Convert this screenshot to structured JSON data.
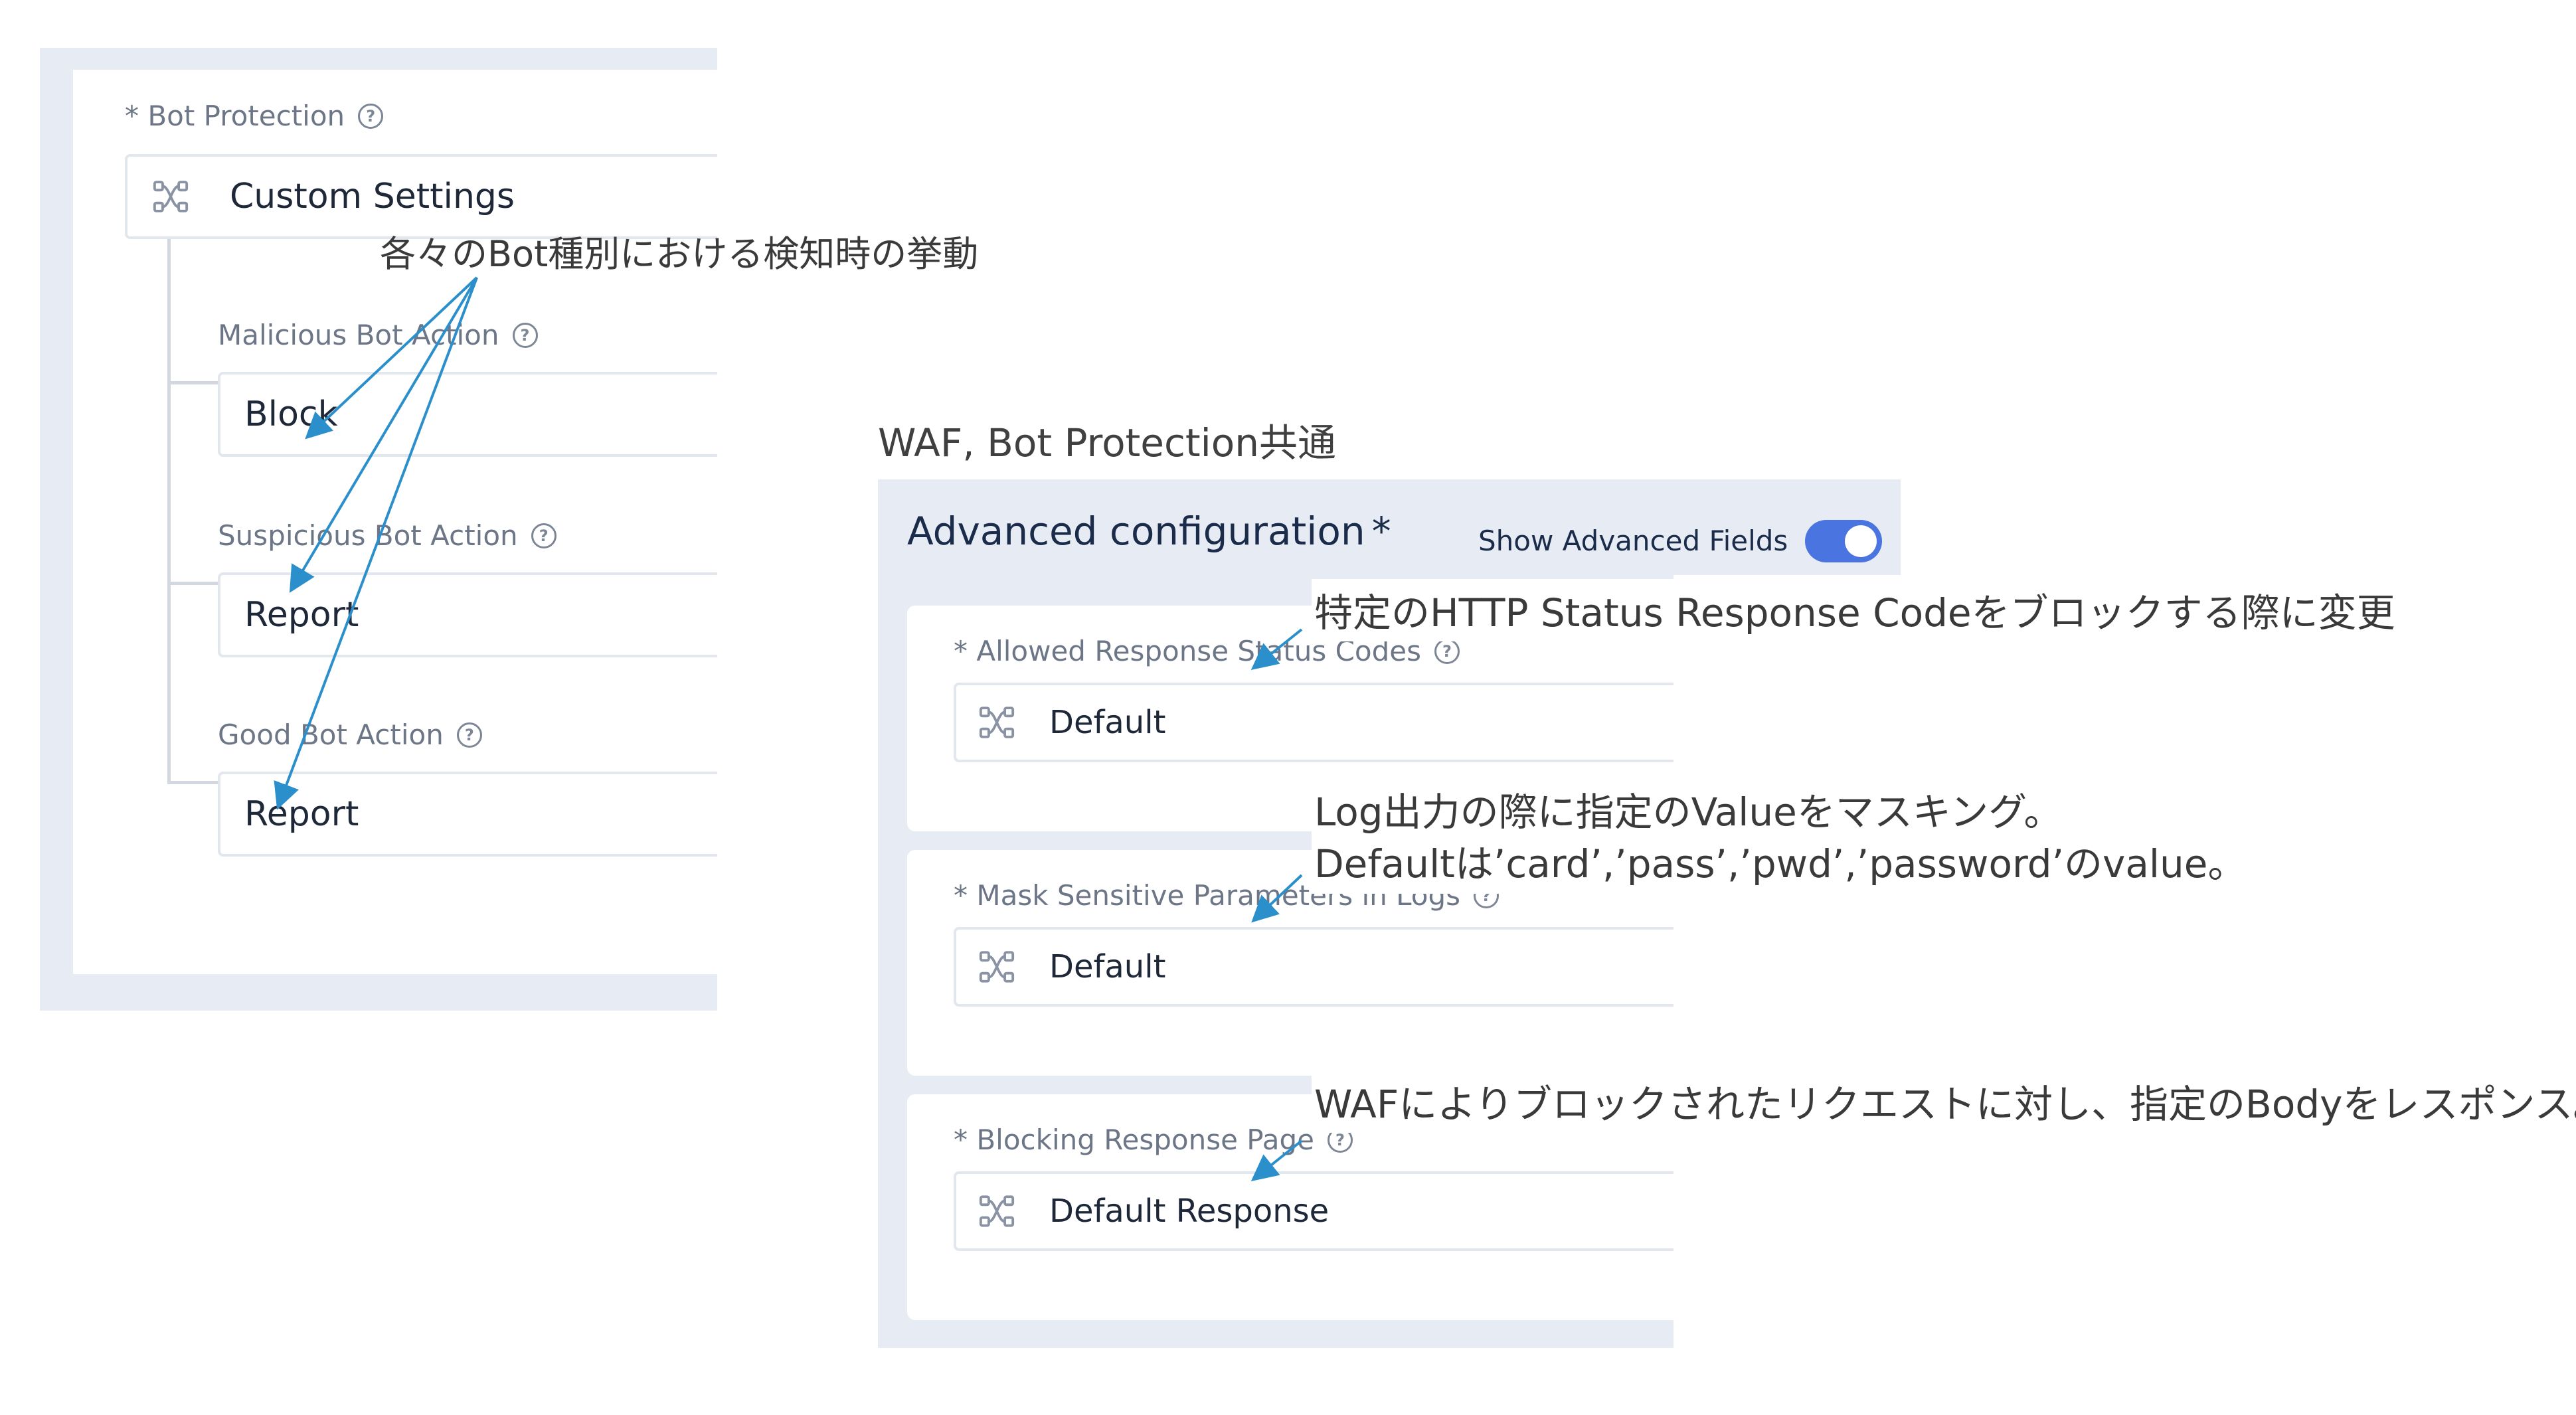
{
  "bot_protection": {
    "label": "* Bot Protection",
    "mode_value": "Custom Settings",
    "malicious": {
      "label": "Malicious Bot Action",
      "value": "Block"
    },
    "suspicious": {
      "label": "Suspicious Bot Action",
      "value": "Report"
    },
    "good": {
      "label": "Good Bot Action",
      "value": "Report"
    }
  },
  "common_caption": "WAF, Bot Protection共通",
  "advanced": {
    "title": "Advanced configuration",
    "required_mark": "*",
    "toggle_label": "Show Advanced Fields",
    "toggle_on": true,
    "fields": [
      {
        "label": "* Allowed Response Status Codes",
        "value": "Default"
      },
      {
        "label": "* Mask Sensitive Parameters in Logs",
        "value": "Default"
      },
      {
        "label": "* Blocking Response Page",
        "value": "Default Response"
      }
    ]
  },
  "annotations": {
    "bot_types": "各々のBot種別における検知時の挙動",
    "status_codes": "特定のHTTP Status Response Codeをブロックする際に変更",
    "mask_line1": "Log出力の際に指定のValueをマスキング。",
    "mask_line2": "Defaultは’card’,’pass’,’pwd’,’password’のvalue。",
    "blocking_page": "WAFによりブロックされたリクエストに対し、指定のBodyをレスポンス。"
  },
  "colors": {
    "panel_bg": "#e7ebf3",
    "arrow": "#2a8fcb",
    "toggle_on": "#4a74e0"
  },
  "icons": {
    "help": "question-circle-icon",
    "select": "nodes-icon",
    "toggle": "toggle-switch"
  },
  "help_glyph": "?"
}
